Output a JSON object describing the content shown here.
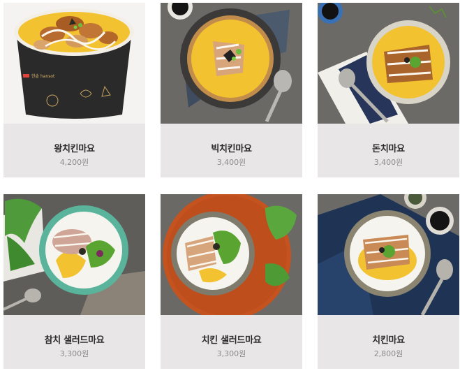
{
  "menu": {
    "items": [
      {
        "name": "왕치킨마요",
        "price": "4,200원"
      },
      {
        "name": "빅치킨마요",
        "price": "3,400원"
      },
      {
        "name": "돈치마요",
        "price": "3,400원"
      },
      {
        "name": "참치 샐러드마요",
        "price": "3,300원"
      },
      {
        "name": "치킨 샐러드마요",
        "price": "3,300원"
      },
      {
        "name": "치킨마요",
        "price": "2,800원"
      }
    ],
    "packaging_brand": "한솥 hansot"
  },
  "colors": {
    "card_bg": "#e8e6e6",
    "name_text": "#2b2b2b",
    "price_text": "#8c8c8c",
    "egg_yellow": "#f2c230",
    "rice_white": "#f6f4ee"
  }
}
